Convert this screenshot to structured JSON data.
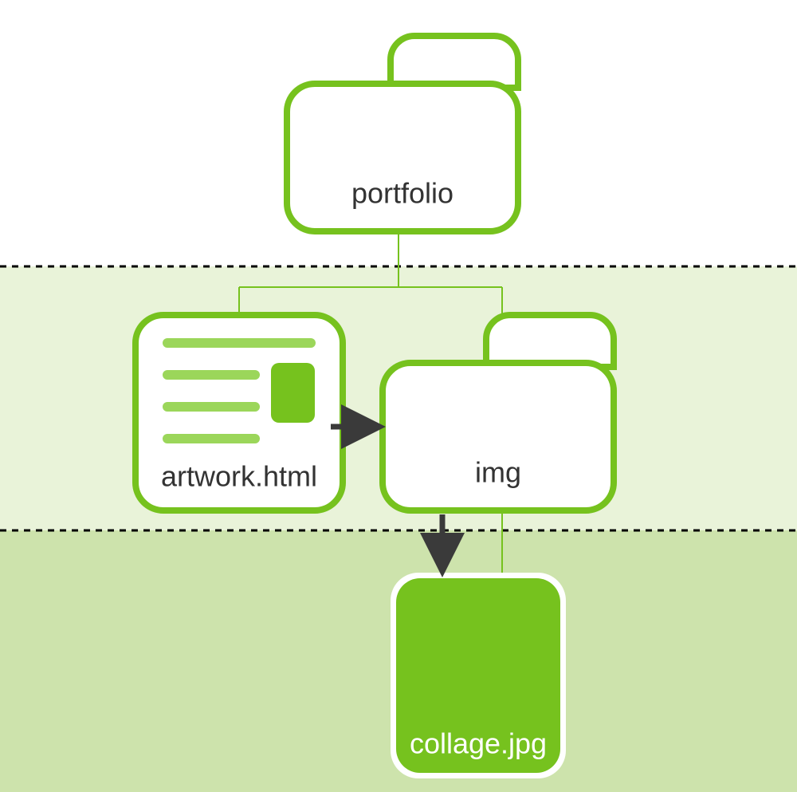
{
  "diagram": {
    "root_folder": {
      "label": "portfolio"
    },
    "html_file": {
      "label": "artwork.html"
    },
    "sub_folder": {
      "label": "img"
    },
    "image_file": {
      "label": "collage.jpg"
    }
  },
  "colors": {
    "green_stroke": "#76c21e",
    "green_fill": "#76c21e",
    "green_light": "#9bd65a",
    "band_light": "#e9f3d9",
    "band_dark": "#cde3ac",
    "arrow": "#3a3a3a",
    "text": "#333333"
  }
}
